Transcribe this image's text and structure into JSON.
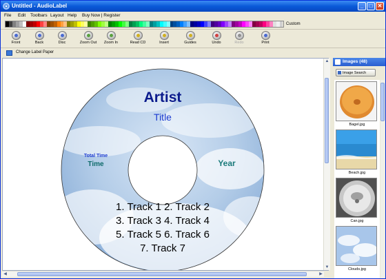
{
  "window": {
    "title": "Untitled - AudioLabel",
    "controls": {
      "minimize": "_",
      "maximize": "□",
      "close": "✕"
    }
  },
  "menu": [
    "File",
    "Edit",
    "Toolbars",
    "Layout",
    "Help",
    "Buy Now | Register"
  ],
  "palette": {
    "custom_label": "Custom",
    "colors": [
      "#000000",
      "#404040",
      "#808080",
      "#a0a0a0",
      "#c0c0c0",
      "#ffffff",
      "#800000",
      "#a00000",
      "#c00000",
      "#ff0000",
      "#ff4040",
      "#ff8080",
      "#804000",
      "#a05000",
      "#c06000",
      "#ff8000",
      "#ffa040",
      "#ffc080",
      "#808000",
      "#a0a000",
      "#c0c000",
      "#ffff00",
      "#ffff60",
      "#ffffa0",
      "#408000",
      "#50a000",
      "#60c000",
      "#80ff00",
      "#a0ff40",
      "#c0ff80",
      "#008000",
      "#00a000",
      "#00c000",
      "#00ff00",
      "#40ff40",
      "#80ff80",
      "#008040",
      "#00a050",
      "#00c060",
      "#00ff80",
      "#40ffa0",
      "#80ffc0",
      "#008080",
      "#00a0a0",
      "#00c0c0",
      "#00ffff",
      "#40ffff",
      "#80ffff",
      "#004080",
      "#0050a0",
      "#0060c0",
      "#0080ff",
      "#40a0ff",
      "#80c0ff",
      "#000080",
      "#0000a0",
      "#0000c0",
      "#0000ff",
      "#4040ff",
      "#8080ff",
      "#400080",
      "#5000a0",
      "#6000c0",
      "#8000ff",
      "#a040ff",
      "#c080ff",
      "#800080",
      "#a000a0",
      "#c000c0",
      "#ff00ff",
      "#ff40ff",
      "#ff80ff",
      "#800040",
      "#a00050",
      "#c00060",
      "#ff0080",
      "#ff40a0",
      "#ff80c0",
      "#e0e0e0",
      "#f0f0f0",
      "#d0d0d0"
    ]
  },
  "toolbar": {
    "front": "Front",
    "back": "Back",
    "disc": "Disc",
    "zoom_out": "Zoom Out",
    "zoom_in": "Zoom In",
    "read_cd": "Read CD",
    "insert": "Insert",
    "guides": "Guides",
    "undo": "Undo",
    "redo": "Redo",
    "print": "Print"
  },
  "paper_bar": {
    "label": "Change Label Paper"
  },
  "disc": {
    "artist": "Artist",
    "title": "Title",
    "total_time_label": "Total Time",
    "time": "Time",
    "year": "Year",
    "tracks_line1": "1. Track 1   2. Track 2",
    "tracks_line2": "3. Track 3   4. Track 4",
    "tracks_line3": "5. Track 5   6. Track 6",
    "tracks_line4": "7. Track 7"
  },
  "images_panel": {
    "header": "Images (48)",
    "search_button": "Image Search",
    "items": [
      {
        "label": "Bagel.jpg",
        "icon": "bagel-image"
      },
      {
        "label": "Beach.jpg",
        "icon": "beach-image"
      },
      {
        "label": "Can.jpg",
        "icon": "can-image"
      },
      {
        "label": "Clouds.jpg",
        "icon": "clouds-image"
      }
    ]
  },
  "colors": {
    "artist": "#0a1a8c",
    "title": "#1a3ad0",
    "time": "#0e6a6a",
    "year": "#1a7a7a"
  }
}
